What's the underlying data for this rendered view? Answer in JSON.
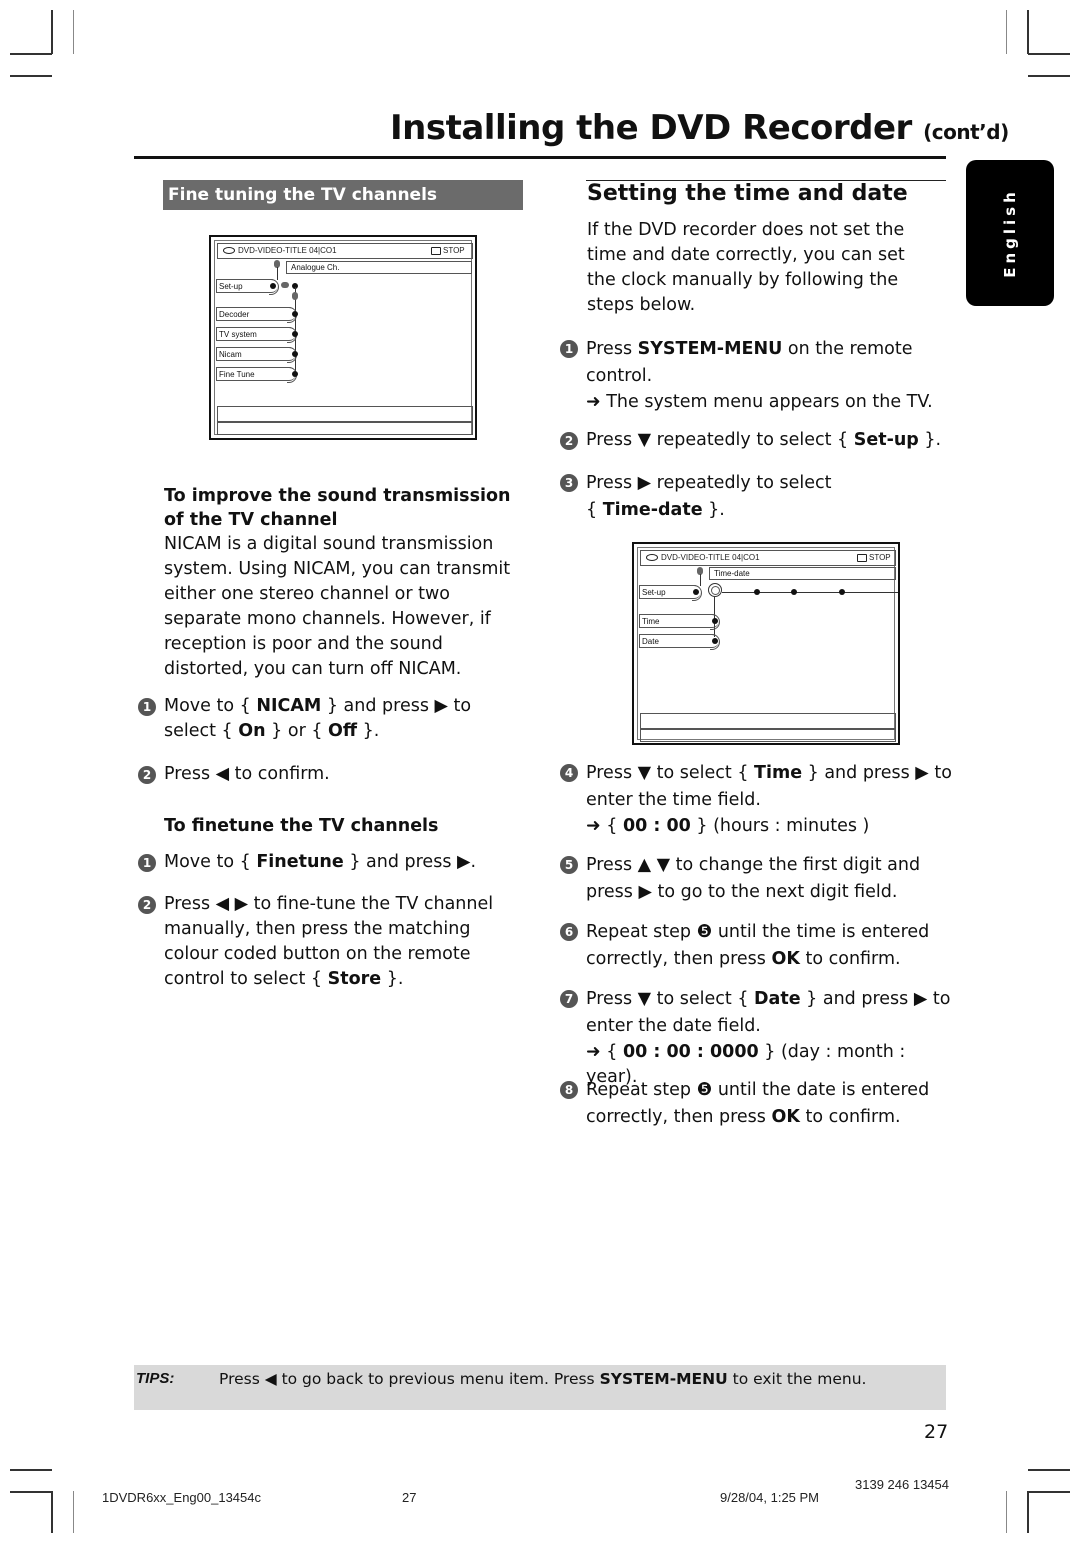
{
  "header": {
    "title": "Installing the DVD Recorder",
    "title_suffix": "(cont’d)"
  },
  "language_tab": "English",
  "left": {
    "section_title": "Fine tuning the TV channels",
    "menu": {
      "header_left": "DVD-VIDEO-TITLE 04|CO1",
      "header_right": "STOP",
      "submenu_label": "Analogue Ch.",
      "root_item": "Set-up",
      "items": [
        "Decoder",
        "TV system",
        "Nicam",
        "Fine Tune"
      ]
    },
    "subsection1": {
      "heading": "To improve the sound transmission of the TV channel",
      "body": "NICAM is a digital sound transmission system.  Using NICAM, you can transmit either one stereo channel or two separate mono channels.  However, if reception is poor and the sound distorted, you can turn off NICAM.",
      "steps": [
        {
          "num": "1",
          "parts": [
            "Move to { ",
            "NICAM",
            " } and press ▶ to select { ",
            "On",
            " } or { ",
            "Off",
            " }."
          ]
        },
        {
          "num": "2",
          "parts": [
            "Press ◀ to confirm."
          ]
        }
      ]
    },
    "subsection2": {
      "heading": "To finetune the TV channels",
      "steps": [
        {
          "num": "1",
          "parts": [
            "Move to { ",
            "Finetune",
            " } and press ▶."
          ]
        },
        {
          "num": "2",
          "parts": [
            "Press ◀ ▶ to fine-tune the TV channel manually, then press the matching colour coded button on the remote control to select { ",
            "Store",
            " }."
          ]
        }
      ]
    }
  },
  "right": {
    "section_title": "Setting the time and date",
    "intro": "If the DVD recorder does not set the time and date correctly, you can set the clock manually by following the steps below.",
    "steps": [
      {
        "num": "1",
        "parts": [
          "Press ",
          "SYSTEM-MENU",
          " on the remote control."
        ],
        "result": "➜ The system menu appears on the TV."
      },
      {
        "num": "2",
        "parts": [
          "Press ▼ repeatedly to select { ",
          "Set-up",
          " }."
        ]
      },
      {
        "num": "3",
        "parts": [
          "Press ▶ repeatedly to select { ",
          "Time-date",
          " }."
        ]
      },
      {
        "num": "4",
        "parts": [
          "Press ▼ to select { ",
          "Time",
          " } and press ▶ to enter the time field."
        ],
        "result_parts": [
          "➜ { ",
          "00 : 00",
          " } (hours : minutes )"
        ]
      },
      {
        "num": "5",
        "parts": [
          "Press ▲ ▼ to change the first digit and press ▶ to go to the next digit field."
        ]
      },
      {
        "num": "6",
        "parts": [
          "Repeat step ❺ until the time is entered correctly, then press ",
          "OK",
          " to confirm."
        ]
      },
      {
        "num": "7",
        "parts": [
          "Press ▼ to select { ",
          "Date",
          " } and press ▶ to enter the date field."
        ],
        "result_parts": [
          "➜ { ",
          "00 : 00 : 0000",
          " } (day : month : year)."
        ]
      },
      {
        "num": "8",
        "parts": [
          "Repeat step ❺ until the date is entered correctly, then press ",
          "OK",
          " to confirm."
        ]
      }
    ],
    "menu": {
      "header_left": "DVD-VIDEO-TITLE 04|CO1",
      "header_right": "STOP",
      "submenu_label": "Time-date",
      "root_item": "Set-up",
      "items": [
        "Time",
        "Date"
      ]
    }
  },
  "tips": {
    "label": "TIPS:",
    "parts": [
      "Press ◀ to go back to previous menu item.  Press ",
      "SYSTEM-MENU",
      " to exit the menu."
    ]
  },
  "page_number": "27",
  "footer": {
    "file": "1DVDR6xx_Eng00_13454c",
    "page": "27",
    "date": "9/28/04, 1:25 PM",
    "code": "3139 246 13454"
  }
}
